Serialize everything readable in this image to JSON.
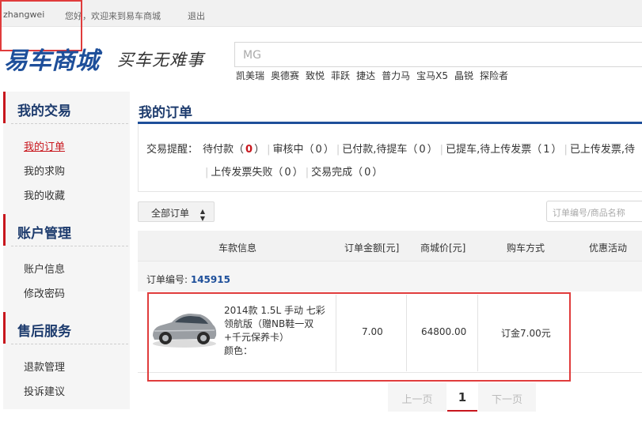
{
  "topbar": {
    "username": "zhangwei",
    "welcome": "您好，欢迎来到易车商城",
    "logout": "退出"
  },
  "header": {
    "logo": "易车商城",
    "slogan": "买车无难事",
    "search_value": "MG",
    "hot_words": [
      "凯美瑞",
      "奥德赛",
      "致悦",
      "菲跃",
      "捷达",
      "普力马",
      "宝马X5",
      "晶锐",
      "探险者"
    ]
  },
  "sidebar": {
    "sections": [
      {
        "title": "我的交易",
        "items": [
          "我的订单",
          "我的求购",
          "我的收藏"
        ]
      },
      {
        "title": "账户管理",
        "items": [
          "账户信息",
          "修改密码"
        ]
      },
      {
        "title": "售后服务",
        "items": [
          "退款管理",
          "投诉建议"
        ]
      }
    ],
    "active_item": "我的订单"
  },
  "main": {
    "title": "我的订单",
    "reminder": {
      "label": "交易提醒：",
      "items": [
        {
          "label": "待付款",
          "count": "0"
        },
        {
          "label": "审核中",
          "count": "0"
        },
        {
          "label": "已付款,待提车",
          "count": "0"
        },
        {
          "label": "已提车,待上传发票",
          "count": "1"
        },
        {
          "label": "已上传发票,待",
          "count": ""
        },
        {
          "label": "上传发票失败",
          "count": "0"
        },
        {
          "label": "交易完成",
          "count": "0"
        }
      ]
    },
    "filter": {
      "selected": "全部订单"
    },
    "order_search_placeholder": "订单编号/商品名称",
    "table": {
      "columns": [
        "车款信息",
        "订单金额[元]",
        "商城价[元]",
        "购车方式",
        "优惠活动"
      ]
    },
    "order": {
      "number_label": "订单编号: ",
      "number": "145915",
      "car_name": "2014款 1.5L 手动 七彩领航版（赠NB鞋一双+千元保养卡）",
      "color_label": "颜色：",
      "order_amount": "7.00",
      "mall_price": "64800.00",
      "purchase_method": "订金7.00元",
      "promotion": ""
    }
  },
  "pagination": {
    "prev": "上一页",
    "current": "1",
    "next": "下一页"
  },
  "colors": {
    "brand_blue": "#1e4f9a",
    "accent_red": "#c8161d",
    "highlight_box": "#e03c3c"
  },
  "icons": {
    "filter_caret": "caret-updown-icon",
    "car_image": "car-photo"
  }
}
